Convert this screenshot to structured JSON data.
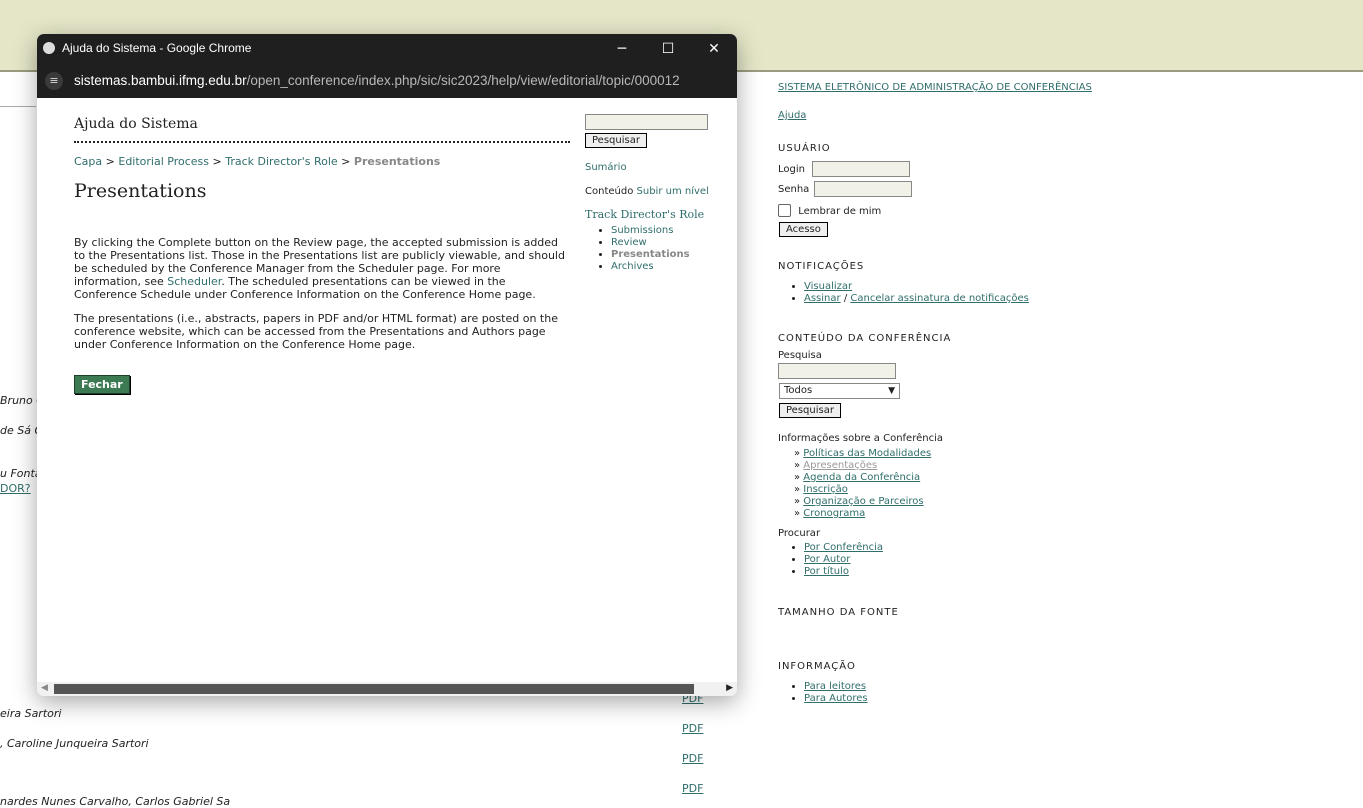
{
  "background": {
    "partial_texts": [
      "Bruno C",
      "de Sá C",
      "u Fonta",
      "eira Sartori",
      ", Caroline Junqueira Sartori",
      "nardes Nunes Carvalho, Carlos Gabriel Sa"
    ],
    "partial_links": [
      "DOR?"
    ],
    "pdf_links": [
      "PDF",
      "PDF",
      "PDF",
      "PDF"
    ]
  },
  "sidebar": {
    "system_title": "SISTEMA ELETRÔNICO DE ADMINISTRAÇÃO DE CONFERÊNCIAS",
    "help_link": "Ajuda",
    "user": {
      "heading": "USUÁRIO",
      "login_label": "Login",
      "password_label": "Senha",
      "remember_label": "Lembrar de mim",
      "submit": "Acesso"
    },
    "notifications": {
      "heading": "NOTIFICAÇÕES",
      "view": "Visualizar",
      "subscribe": "Assinar",
      "separator": "/",
      "unsubscribe": "Cancelar assinatura de notificações"
    },
    "content": {
      "heading": "CONTEÚDO DA CONFERÊNCIA",
      "search_label": "Pesquisa",
      "scope_selected": "Todos",
      "search_button": "Pesquisar",
      "info_label": "Informações sobre a Conferência",
      "info_links": [
        "Políticas das Modalidades",
        "Apresentações",
        "Agenda da Conferência",
        "Inscrição",
        "Organização e Parceiros",
        "Cronograma"
      ],
      "browse_label": "Procurar",
      "browse_links": [
        "Por Conferência",
        "Por Autor",
        "Por título"
      ]
    },
    "font_size_heading": "TAMANHO DA FONTE",
    "information": {
      "heading": "INFORMAÇÃO",
      "links": [
        "Para leitores",
        "Para Autores"
      ]
    }
  },
  "popup": {
    "window_title": "Ajuda do Sistema - Google Chrome",
    "url_domain": "sistemas.bambui.ifmg.edu.br",
    "url_path": "/open_conference/index.php/sic/sic2023/help/view/editorial/topic/000012",
    "site_heading": "Ajuda do Sistema",
    "breadcrumb": {
      "home": "Capa",
      "sep": ">",
      "editorial": "Editorial Process",
      "role": "Track Director's Role",
      "current": "Presentations"
    },
    "page_title": "Presentations",
    "para1_before": "By clicking the Complete button on the Review page, the accepted submission is added to the Presentations list. Those in the Presentations list are publicly viewable, and should be scheduled by the Conference Manager from the Scheduler page. For more information, see ",
    "para1_link": "Scheduler",
    "para1_after": ". The scheduled presentations can be viewed in the Conference Schedule under Conference Information on the Conference Home page.",
    "para2": "The presentations (i.e., abstracts, papers in PDF and/or HTML format) are posted on the conference website, which can be accessed from the Presentations and Authors page under Conference Information on the Conference Home page.",
    "close_button": "Fechar",
    "right": {
      "search_button": "Pesquisar",
      "toc": "Sumário",
      "content_label": "Conteúdo",
      "up_level": "Subir um nível",
      "section_title": "Track Director's Role",
      "items": [
        "Submissions",
        "Review",
        "Presentations",
        "Archives"
      ]
    }
  }
}
